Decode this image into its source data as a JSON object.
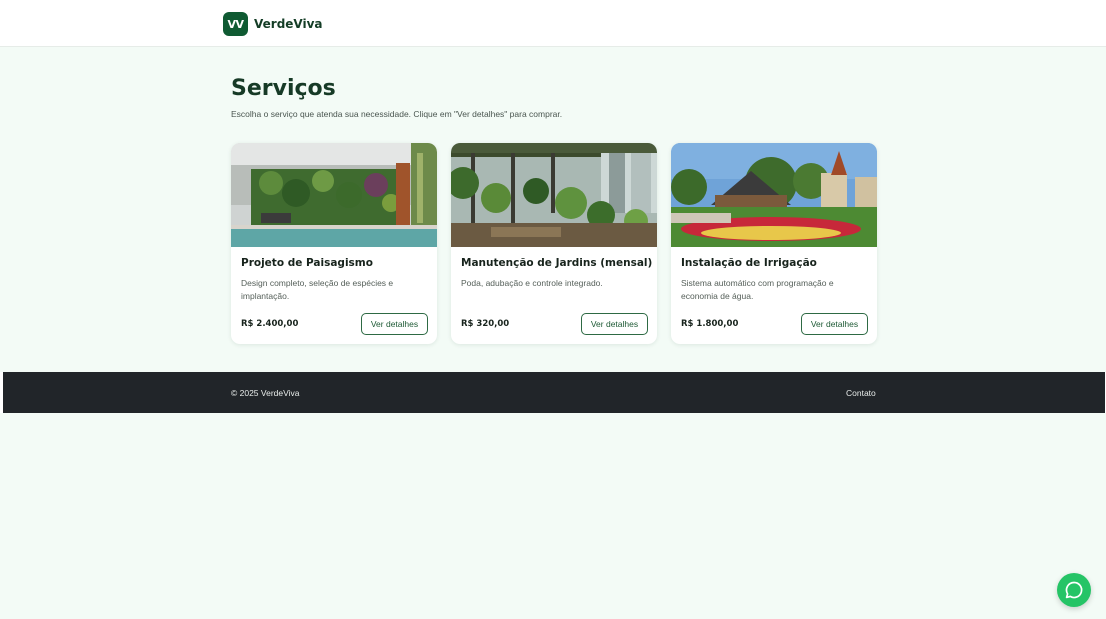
{
  "header": {
    "logo_text": "VV",
    "brand_name": "VerdeViva"
  },
  "main": {
    "title": "Serviços",
    "subtitle": "Escolha o serviço que atenda sua necessidade. Clique em \"Ver detalhes\" para comprar."
  },
  "cards": [
    {
      "title": "Projeto de Paisagismo",
      "description": "Design completo, seleção de espécies e implantação.",
      "price": "R$ 2.400,00",
      "button_label": "Ver detalhes"
    },
    {
      "title": "Manutenção de Jardins (mensal)",
      "description": "Poda, adubação e controle integrado.",
      "price": "R$ 320,00",
      "button_label": "Ver detalhes"
    },
    {
      "title": "Instalação de Irrigação",
      "description": "Sistema automático com programação e economia de água.",
      "price": "R$ 1.800,00",
      "button_label": "Ver detalhes"
    }
  ],
  "footer": {
    "copyright": "© 2025 VerdeViva",
    "contact_link": "Contato"
  },
  "icons": {
    "chat": "chat-bubble-icon"
  },
  "colors": {
    "brand_dark_green": "#0f5a32",
    "page_background": "#f3fbf6",
    "footer_background": "#212529",
    "chat_button": "#25c466"
  }
}
